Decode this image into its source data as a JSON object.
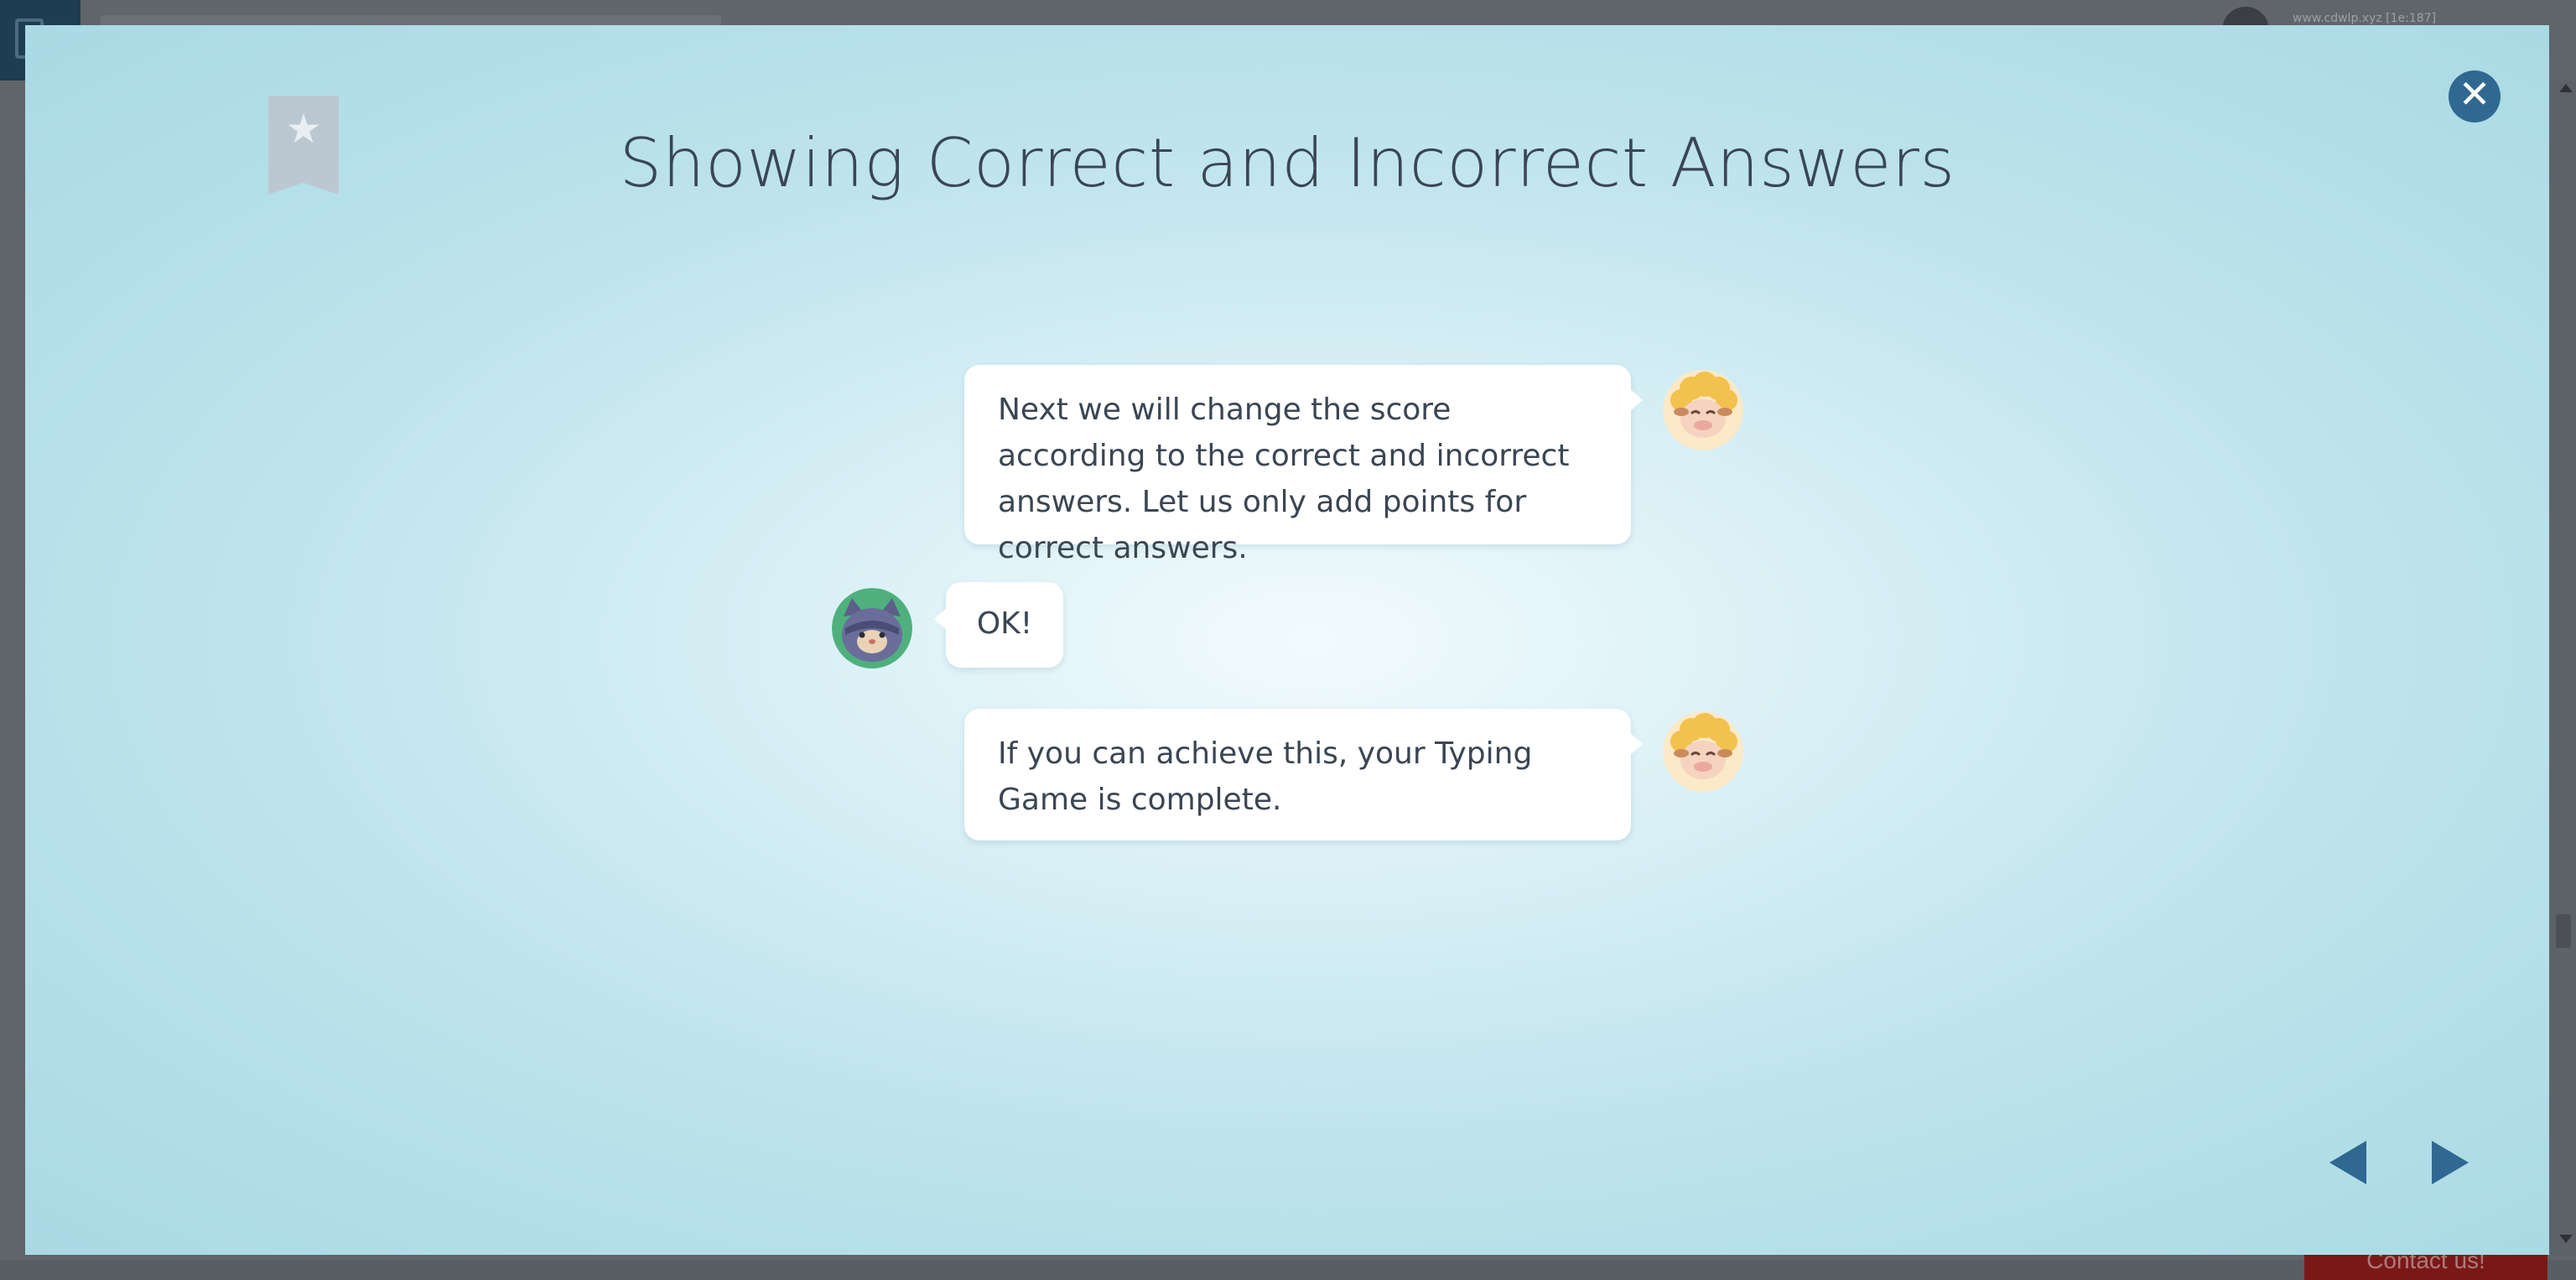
{
  "background": {
    "user_text": "www.cdwlp.xyz [1e:187]",
    "contact_label": "Contact us!"
  },
  "lesson": {
    "title": "Showing Correct and Incorrect Answers",
    "close_icon": "close-icon",
    "bookmark_icon": "star-bookmark-icon"
  },
  "dialogue": [
    {
      "speaker": "sheep",
      "side": "right",
      "text": "Next we will change the score according to the correct and incorrect answers. Let us only add points for correct answers."
    },
    {
      "speaker": "cat",
      "side": "left",
      "text": "OK!"
    },
    {
      "speaker": "sheep",
      "side": "right",
      "text": "If you can achieve this, your Typing Game is complete."
    }
  ],
  "navigation": {
    "prev_icon": "triangle-left-icon",
    "next_icon": "triangle-right-icon"
  },
  "colors": {
    "accent": "#2f6991",
    "title_text": "#3a4654",
    "bubble_bg": "#ffffff",
    "backdrop_center": "#f2fbfd",
    "backdrop_edge": "#a9d9e4"
  }
}
